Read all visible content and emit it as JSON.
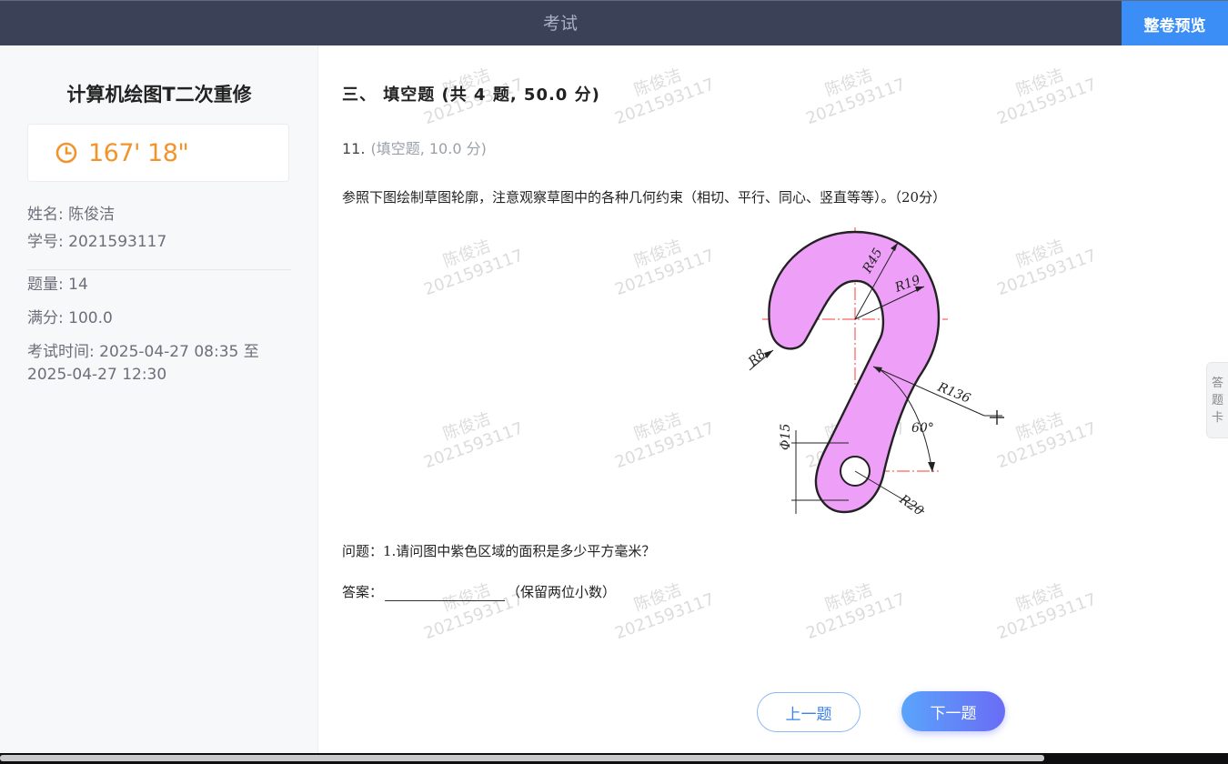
{
  "header": {
    "title": "考试",
    "preview_label": "整卷预览"
  },
  "sidebar": {
    "course_title": "计算机绘图T二次重修",
    "timer": "167' 18\"",
    "name_label": "姓名:",
    "name": "陈俊洁",
    "id_label": "学号:",
    "student_id": "2021593117",
    "count_label": "题量:",
    "count": "14",
    "score_label": "满分:",
    "score": "100.0",
    "time_label": "考试时间:",
    "time_start": "2025-04-27  08:35",
    "time_to": "至",
    "time_end": "2025-04-27  12:30"
  },
  "main": {
    "section_title": "三、  填空题  (共 4 题, 50.0 分)",
    "question_number": "11.",
    "question_meta": "(填空题, 10.0 分)",
    "question_text": "参照下图绘制草图轮廓，注意观察草图中的各种几何约束（相切、平行、同心、竖直等等）。（20分）",
    "ask": "问题：1.请问图中紫色区域的面积是多少平方毫米？",
    "answer_prefix": "答案：",
    "answer_suffix": "（保留两位小数）",
    "watermark_name": "陈俊洁",
    "watermark_id": "2021593117",
    "figure_labels": {
      "r45": "R45",
      "r19": "R19",
      "r8": "R8",
      "r136": "R136",
      "angle": "60°",
      "dia15": "Φ15",
      "r20": "R20"
    }
  },
  "buttons": {
    "prev": "上一题",
    "next": "下一题"
  },
  "answer_card": [
    "答",
    "题",
    "卡"
  ],
  "colors": {
    "accent": "#3a8ef6",
    "timer": "#f0952e",
    "fill": "#ee9ff7",
    "header": "#3b4258"
  },
  "icons": {
    "timer": "clock-icon"
  }
}
